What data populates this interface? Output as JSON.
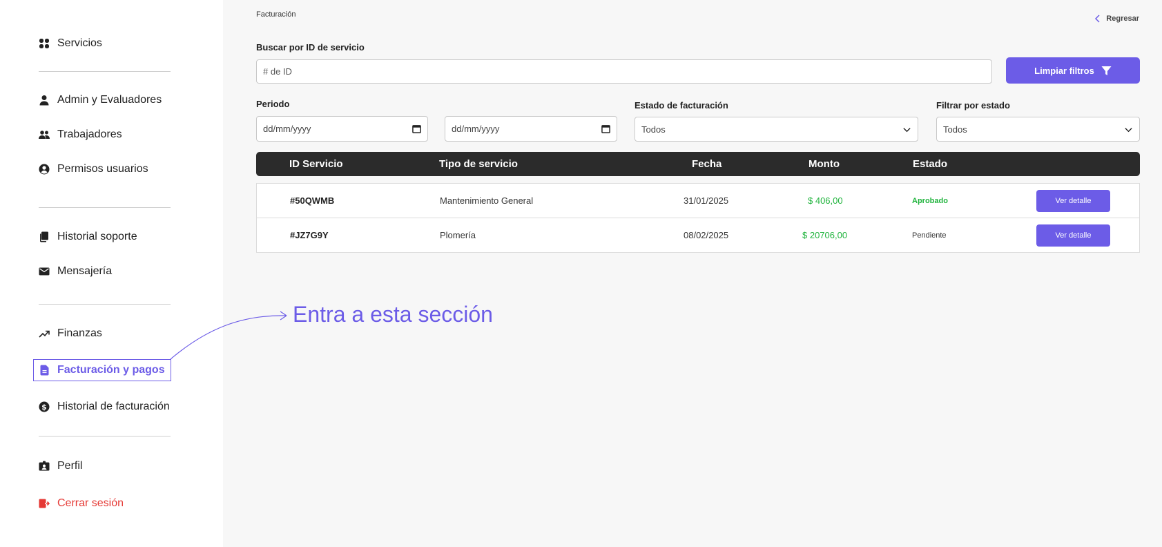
{
  "sidebar": {
    "items": [
      {
        "label": "Servicios",
        "icon": "grid-icon"
      },
      {
        "label": "Admin y Evaluadores",
        "icon": "user-icon"
      },
      {
        "label": "Trabajadores",
        "icon": "users-icon"
      },
      {
        "label": "Permisos usuarios",
        "icon": "user-circle-icon"
      },
      {
        "label": "Historial soporte",
        "icon": "copy-icon"
      },
      {
        "label": "Mensajería",
        "icon": "mail-icon"
      },
      {
        "label": "Finanzas",
        "icon": "trend-up-icon"
      },
      {
        "label": "Facturación y pagos",
        "icon": "document-icon"
      },
      {
        "label": "Historial de facturación",
        "icon": "dollar-circle-icon"
      },
      {
        "label": "Perfil",
        "icon": "id-card-icon"
      },
      {
        "label": "Cerrar sesión",
        "icon": "logout-icon"
      }
    ]
  },
  "header": {
    "breadcrumb": "Facturación",
    "back_label": "Regresar"
  },
  "filters": {
    "search_label": "Buscar por ID de servicio",
    "search_placeholder": "# de ID",
    "clear_label": "Limpiar filtros",
    "period_label": "Periodo",
    "date_from": "dd/mm/yyyy",
    "date_to": "dd/mm/yyyy",
    "billing_state_label": "Estado de facturación",
    "billing_state_value": "Todos",
    "filter_state_label": "Filtrar por estado",
    "filter_state_value": "Todos"
  },
  "table": {
    "columns": [
      "ID Servicio",
      "Tipo de servicio",
      "Fecha",
      "Monto",
      "Estado"
    ],
    "rows": [
      {
        "id": "#50QWMB",
        "tipo": "Mantenimiento General",
        "fecha": "31/01/2025",
        "monto": "$ 406,00",
        "estado": "Aprobado",
        "action": "Ver detalle"
      },
      {
        "id": "#JZ7G9Y",
        "tipo": "Plomería",
        "fecha": "08/02/2025",
        "monto": "$ 20706,00",
        "estado": "Pendiente",
        "action": "Ver detalle"
      }
    ]
  },
  "annotation": {
    "text": "Entra a esta sección"
  },
  "colors": {
    "accent": "#6c5ce7",
    "approved": "#1eb33b",
    "logout": "#e53935",
    "table_header": "#2b2b2b"
  }
}
